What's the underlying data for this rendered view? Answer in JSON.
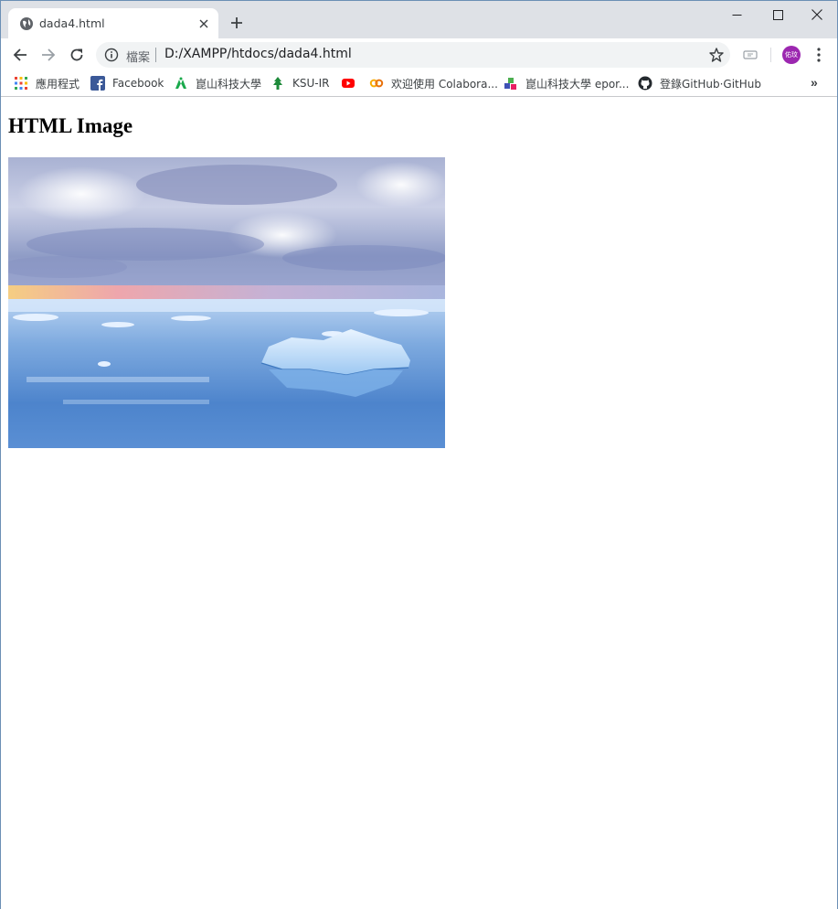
{
  "tab": {
    "title": "dada4.html",
    "icon": "globe-icon"
  },
  "window_controls": [
    "minimize-icon",
    "maximize-icon",
    "close-icon"
  ],
  "toolbar": {
    "scheme_label": "檔案",
    "url": "D:/XAMPP/htdocs/dada4.html",
    "avatar_text": "佑玟",
    "avatar_color": "#9c27b0"
  },
  "bookmarks": [
    {
      "label": "應用程式",
      "icon": "apps-grid-icon"
    },
    {
      "label": "Facebook",
      "icon": "facebook-icon"
    },
    {
      "label": "崑山科技大學",
      "icon": "ksu-logo-icon"
    },
    {
      "label": "KSU-IR",
      "icon": "tree-icon"
    },
    {
      "label": "",
      "icon": "youtube-icon"
    },
    {
      "label": "欢迎使用 Colabora...",
      "icon": "colab-icon"
    },
    {
      "label": "崑山科技大學 epor...",
      "icon": "cubes-icon"
    },
    {
      "label": "登錄GitHub·GitHub",
      "icon": "github-icon"
    }
  ],
  "bookmarks_overflow": "»",
  "page": {
    "heading": "HTML Image",
    "image": {
      "description": "iceberg floating on calm sea under cloudy sky"
    }
  }
}
